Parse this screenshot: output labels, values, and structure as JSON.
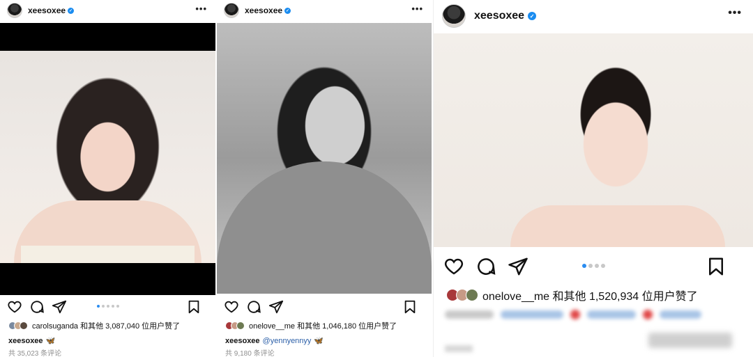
{
  "posts": [
    {
      "username": "xeesoxee",
      "more_label": "•••",
      "likes_text": "carolsuganda 和其他 3,087,040 位用户赞了",
      "caption_user": "xeesoxee",
      "caption_emoji": "🦋",
      "comments": "共 35,023 条评论",
      "carousel_dots": 5,
      "active_dot": 0
    },
    {
      "username": "xeesoxee",
      "more_label": "•••",
      "likes_text": "onelove__me 和其他 1,046,180 位用户赞了",
      "caption_user": "xeesoxee",
      "caption_mention": "@yennyennyy",
      "caption_emoji": "🦋",
      "comments": "共 9,180 条评论"
    },
    {
      "username": "xeesoxee",
      "more_label": "•••",
      "likes_text": "onelove__me 和其他 1,520,934 位用户赞了",
      "carousel_dots": 4,
      "active_dot": 0
    }
  ],
  "colors": {
    "verified_badge": "#1a8cf0",
    "active_dot": "#2a8cf0",
    "mention": "#2b5fa8",
    "comment_gray": "#8e8e8e"
  },
  "icons": [
    "heart-icon",
    "comment-icon",
    "share-icon",
    "bookmark-icon",
    "more-icon",
    "verified-icon"
  ]
}
